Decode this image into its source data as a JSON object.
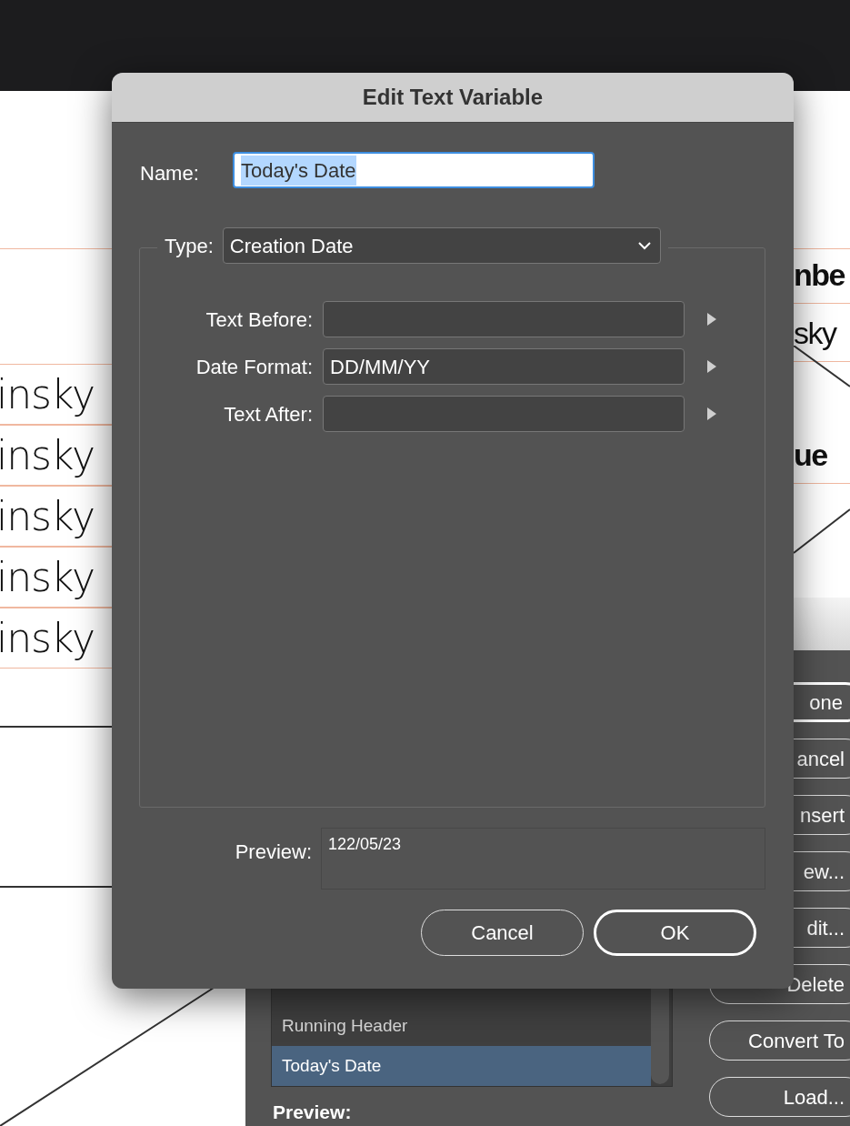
{
  "document": {
    "left_texts": [
      "insky",
      "insky",
      "insky",
      "insky",
      "insky"
    ],
    "right_texts": [
      {
        "text": "nbe",
        "bold": true
      },
      {
        "text": "sky",
        "bold": false
      },
      {
        "text": "ue",
        "bold": true
      }
    ]
  },
  "text_variables_dialog": {
    "list": [
      {
        "label": "Running Header",
        "selected": false
      },
      {
        "label": "Today's Date",
        "selected": true
      }
    ],
    "preview_label": "Preview:",
    "buttons": [
      {
        "label": "one",
        "default": true
      },
      {
        "label": "ancel",
        "default": false
      },
      {
        "label": "nsert",
        "default": false
      },
      {
        "label": "ew...",
        "default": false
      },
      {
        "label": "dit...",
        "default": false
      },
      {
        "label": "Delete",
        "default": false
      },
      {
        "label": "Convert To",
        "default": false
      },
      {
        "label": "Load...",
        "default": false
      }
    ]
  },
  "edit_dialog": {
    "title": "Edit Text Variable",
    "name": {
      "label": "Name:",
      "value": "Today's Date",
      "text_selected": true
    },
    "type": {
      "label": "Type:",
      "value": "Creation Date"
    },
    "fields": [
      {
        "label": "Text Before:"
      },
      {
        "label": "Date Format:",
        "value": "DD/MM/YY"
      },
      {
        "label": "Text After:"
      }
    ],
    "preview": {
      "label": "Preview:",
      "value": "122/05/23"
    },
    "buttons": [
      {
        "label": "Cancel",
        "default": false
      },
      {
        "label": "OK",
        "default": true
      }
    ]
  }
}
